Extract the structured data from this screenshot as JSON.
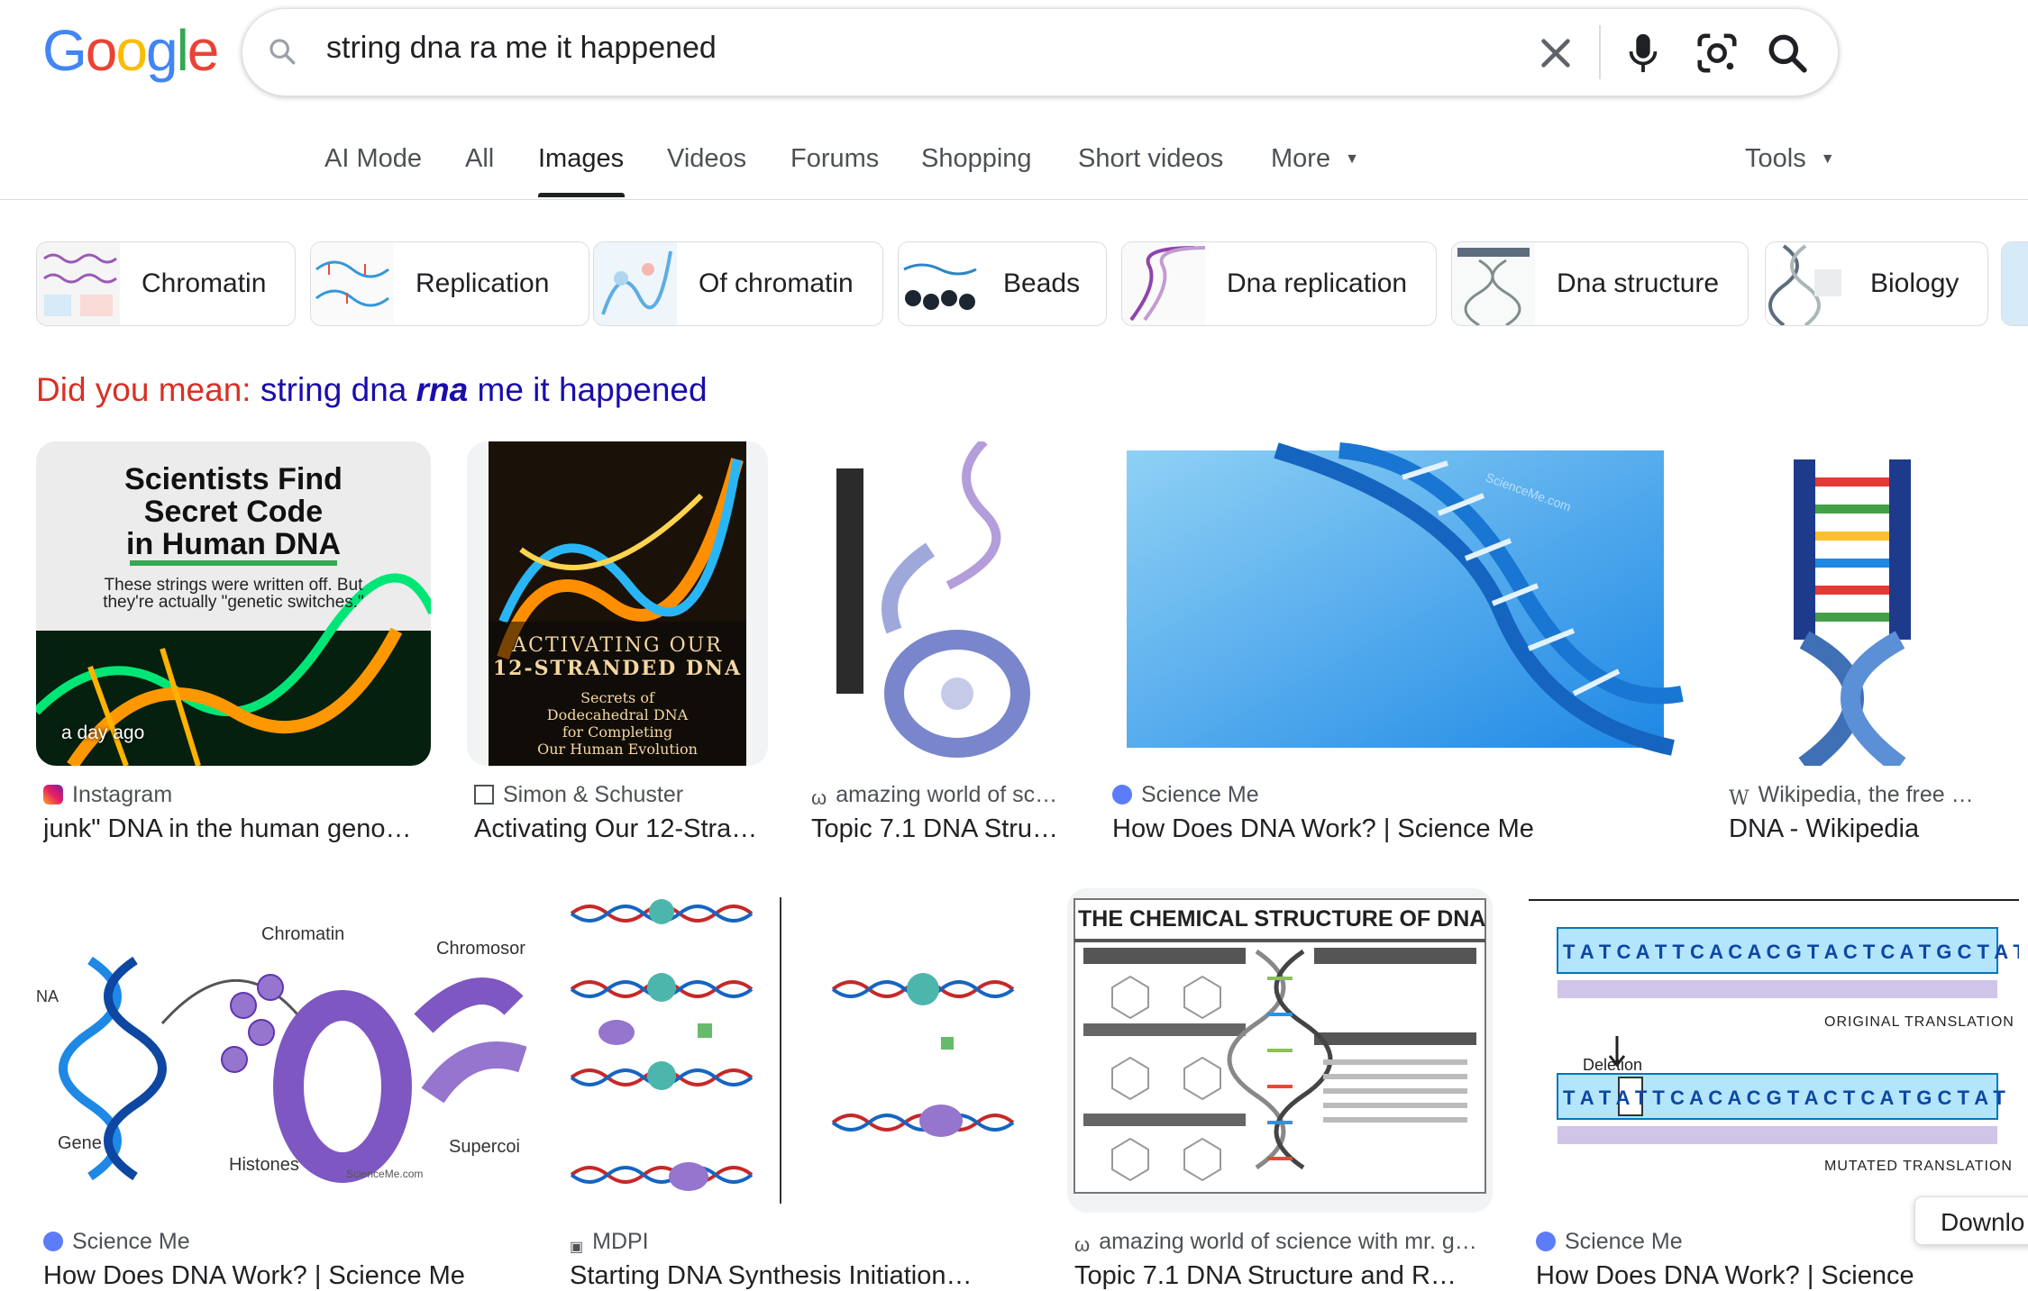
{
  "logo": {
    "text": "Google"
  },
  "search": {
    "query": "string dna ra me it happened"
  },
  "tabs": [
    {
      "label": "AI Mode"
    },
    {
      "label": "All"
    },
    {
      "label": "Images"
    },
    {
      "label": "Videos"
    },
    {
      "label": "Forums"
    },
    {
      "label": "Shopping"
    },
    {
      "label": "Short videos"
    },
    {
      "label": "More"
    }
  ],
  "active_tab": "Images",
  "tools_label": "Tools",
  "chips": [
    {
      "label": "Chromatin"
    },
    {
      "label": "Replication"
    },
    {
      "label": "Of chromatin"
    },
    {
      "label": "Beads"
    },
    {
      "label": "Dna replication"
    },
    {
      "label": "Dna structure"
    },
    {
      "label": "Biology"
    }
  ],
  "did_you_mean": {
    "prefix": "Did you mean:",
    "before": "string dna",
    "emphasis": "rna",
    "after": "me it happened"
  },
  "results": [
    {
      "source": "Instagram",
      "title": "junk\" DNA in the human geno…",
      "badge": "a day ago",
      "thumb_text": {
        "headline1": "Scientists Find",
        "headline2": "Secret Code",
        "headline3": "in Human DNA",
        "sub1": "These strings were written off. But",
        "sub2": "they're actually \"genetic switches.\""
      }
    },
    {
      "source": "Simon & Schuster",
      "title": "Activating Our 12-Stra…",
      "thumb_text": {
        "line1": "ACTIVATING OUR",
        "line2": "12-STRANDED DNA",
        "line3": "Secrets of",
        "line4": "Dodecahedral DNA",
        "line5": "for Completing",
        "line6": "Our Human Evolution"
      }
    },
    {
      "source": "amazing world of sc…",
      "title": "Topic 7.1 DNA Stru…"
    },
    {
      "source": "Science Me",
      "title": "How Does DNA Work? | Science Me",
      "thumb_text": {
        "watermark": "ScienceMe.com"
      }
    },
    {
      "source": "Wikipedia, the free …",
      "title": "DNA - Wikipedia"
    },
    {
      "source": "Science Me",
      "title": "How Does DNA Work? | Science Me",
      "thumb_text": {
        "chromatin": "Chromatin",
        "chromosome": "Chromosor",
        "gene": "Gene",
        "histones": "Histones",
        "supercoil": "Supercoi",
        "na": "NA",
        "site": "ScienceMe.com"
      }
    },
    {
      "source": "MDPI",
      "title": "Starting DNA Synthesis Initiation…"
    },
    {
      "source": "amazing world of science with mr. g…",
      "title": "Topic 7.1 DNA Structure and R…",
      "thumb_text": {
        "heading": "THE CHEMICAL STRUCTURE OF DNA"
      }
    },
    {
      "source": "Science Me",
      "title": "How Does DNA Work? | Science Me",
      "thumb_text": {
        "original": "ORIGINAL TRANSLATION",
        "mutated": "MUTATED TRANSLATION",
        "deletion": "Deletion"
      }
    }
  ],
  "tooltip": {
    "label": "Downlo"
  },
  "colors": {
    "link": "#1a0dab",
    "alert": "#d93025",
    "accent": "#1a73e8"
  }
}
